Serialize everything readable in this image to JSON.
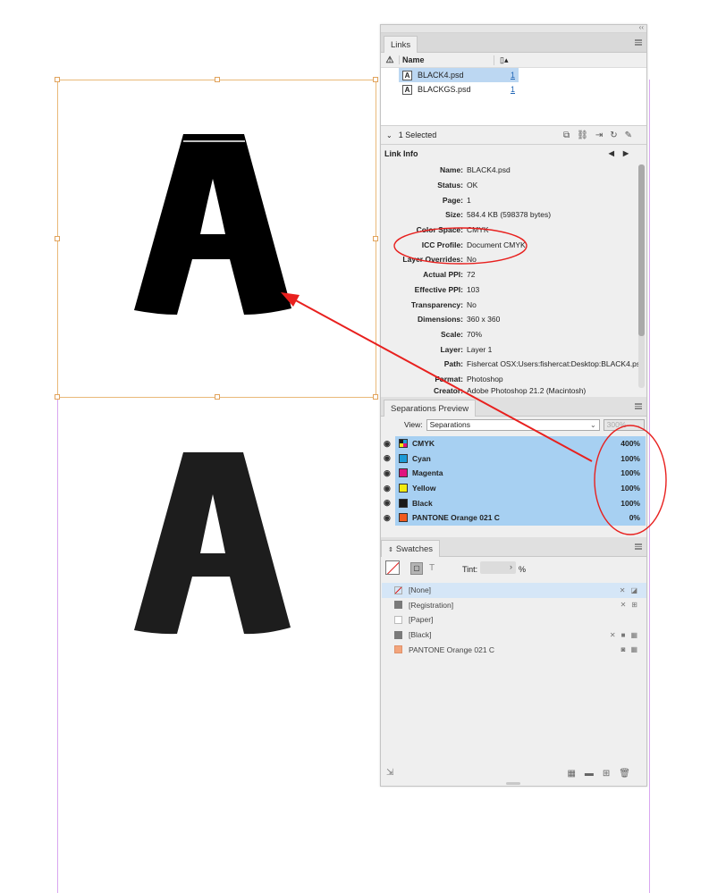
{
  "links_panel": {
    "tab_label": "Links",
    "col_name": "Name",
    "files": [
      {
        "name": "BLACK4.psd",
        "page": "1",
        "thumb": "A"
      },
      {
        "name": "BLACKGS.psd",
        "page": "1",
        "thumb": "A"
      }
    ],
    "selected_text": "1 Selected",
    "link_info_title": "Link Info",
    "info": [
      {
        "label": "Name:",
        "value": "BLACK4.psd"
      },
      {
        "label": "Status:",
        "value": "OK"
      },
      {
        "label": "Page:",
        "value": "1"
      },
      {
        "label": "Size:",
        "value": "584.4 KB (598378 bytes)"
      },
      {
        "label": "Color Space:",
        "value": "CMYK"
      },
      {
        "label": "ICC Profile:",
        "value": "Document CMYK"
      },
      {
        "label": "Layer Overrides:",
        "value": "No"
      },
      {
        "label": "Actual PPI:",
        "value": "72"
      },
      {
        "label": "Effective PPI:",
        "value": "103"
      },
      {
        "label": "Transparency:",
        "value": "No"
      },
      {
        "label": "Dimensions:",
        "value": "360 x 360"
      },
      {
        "label": "Scale:",
        "value": "70%"
      },
      {
        "label": "Layer:",
        "value": "Layer 1"
      },
      {
        "label": "Path:",
        "value": "Fishercat OSX:Users:fishercat:Desktop:BLACK4.psd"
      },
      {
        "label": "Format:",
        "value": "Photoshop"
      },
      {
        "label": "Creator:",
        "value": "Adobe Photoshop 21.2 (Macintosh)"
      }
    ]
  },
  "separations_panel": {
    "tab_label": "Separations Preview",
    "view_label": "View:",
    "view_value": "Separations",
    "zoom_value": "300%",
    "rows": [
      {
        "name": "CMYK",
        "pct": "400%",
        "color": "cmyk"
      },
      {
        "name": "Cyan",
        "pct": "100%",
        "color": "#1c9ad6"
      },
      {
        "name": "Magenta",
        "pct": "100%",
        "color": "#e0147f"
      },
      {
        "name": "Yellow",
        "pct": "100%",
        "color": "#f2ea10"
      },
      {
        "name": "Black",
        "pct": "100%",
        "color": "#1a1a1a"
      },
      {
        "name": "PANTONE Orange 021 C",
        "pct": "0%",
        "color": "#f15a1e"
      }
    ]
  },
  "swatches_panel": {
    "tab_label": "Swatches",
    "tint_label": "Tint:",
    "tint_unit": "%",
    "items": [
      {
        "name": "[None]",
        "chip": "none"
      },
      {
        "name": "[Registration]",
        "chip": "#7a7a7a"
      },
      {
        "name": "[Paper]",
        "chip": "#ffffff"
      },
      {
        "name": "[Black]",
        "chip": "#7a7a7a"
      },
      {
        "name": "PANTONE Orange 021 C",
        "chip": "#f3a57c"
      }
    ]
  },
  "canvas": {
    "letter_top": "A",
    "letter_bottom": "A"
  },
  "colors": {
    "annotation": "#e8201e",
    "selection": "#a7d0f2",
    "frame": "#e9b979",
    "guide": "#d9a6f0"
  }
}
